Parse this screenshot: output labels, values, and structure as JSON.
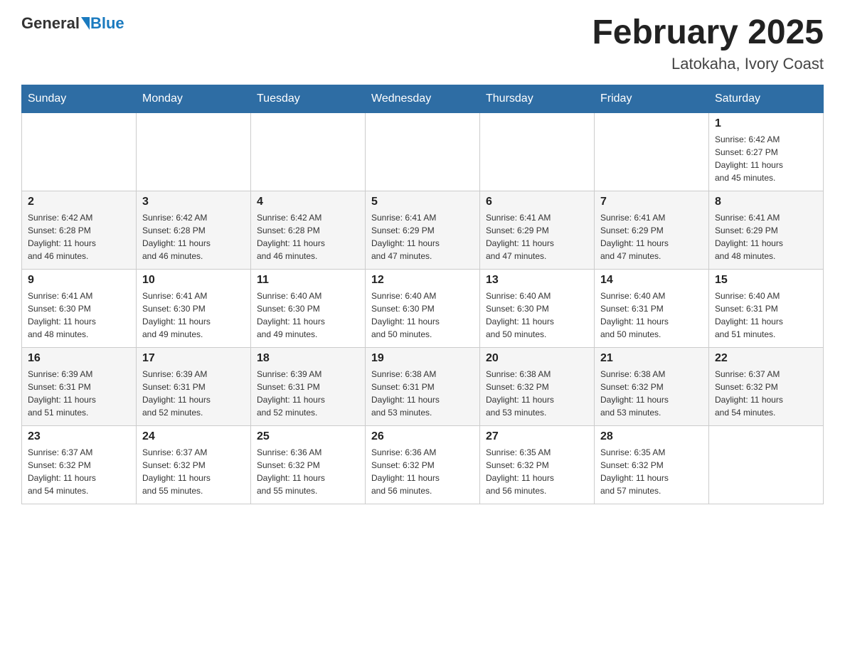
{
  "logo": {
    "general": "General",
    "blue": "Blue"
  },
  "title": "February 2025",
  "location": "Latokaha, Ivory Coast",
  "weekdays": [
    "Sunday",
    "Monday",
    "Tuesday",
    "Wednesday",
    "Thursday",
    "Friday",
    "Saturday"
  ],
  "weeks": [
    [
      {
        "day": "",
        "info": ""
      },
      {
        "day": "",
        "info": ""
      },
      {
        "day": "",
        "info": ""
      },
      {
        "day": "",
        "info": ""
      },
      {
        "day": "",
        "info": ""
      },
      {
        "day": "",
        "info": ""
      },
      {
        "day": "1",
        "info": "Sunrise: 6:42 AM\nSunset: 6:27 PM\nDaylight: 11 hours\nand 45 minutes."
      }
    ],
    [
      {
        "day": "2",
        "info": "Sunrise: 6:42 AM\nSunset: 6:28 PM\nDaylight: 11 hours\nand 46 minutes."
      },
      {
        "day": "3",
        "info": "Sunrise: 6:42 AM\nSunset: 6:28 PM\nDaylight: 11 hours\nand 46 minutes."
      },
      {
        "day": "4",
        "info": "Sunrise: 6:42 AM\nSunset: 6:28 PM\nDaylight: 11 hours\nand 46 minutes."
      },
      {
        "day": "5",
        "info": "Sunrise: 6:41 AM\nSunset: 6:29 PM\nDaylight: 11 hours\nand 47 minutes."
      },
      {
        "day": "6",
        "info": "Sunrise: 6:41 AM\nSunset: 6:29 PM\nDaylight: 11 hours\nand 47 minutes."
      },
      {
        "day": "7",
        "info": "Sunrise: 6:41 AM\nSunset: 6:29 PM\nDaylight: 11 hours\nand 47 minutes."
      },
      {
        "day": "8",
        "info": "Sunrise: 6:41 AM\nSunset: 6:29 PM\nDaylight: 11 hours\nand 48 minutes."
      }
    ],
    [
      {
        "day": "9",
        "info": "Sunrise: 6:41 AM\nSunset: 6:30 PM\nDaylight: 11 hours\nand 48 minutes."
      },
      {
        "day": "10",
        "info": "Sunrise: 6:41 AM\nSunset: 6:30 PM\nDaylight: 11 hours\nand 49 minutes."
      },
      {
        "day": "11",
        "info": "Sunrise: 6:40 AM\nSunset: 6:30 PM\nDaylight: 11 hours\nand 49 minutes."
      },
      {
        "day": "12",
        "info": "Sunrise: 6:40 AM\nSunset: 6:30 PM\nDaylight: 11 hours\nand 50 minutes."
      },
      {
        "day": "13",
        "info": "Sunrise: 6:40 AM\nSunset: 6:30 PM\nDaylight: 11 hours\nand 50 minutes."
      },
      {
        "day": "14",
        "info": "Sunrise: 6:40 AM\nSunset: 6:31 PM\nDaylight: 11 hours\nand 50 minutes."
      },
      {
        "day": "15",
        "info": "Sunrise: 6:40 AM\nSunset: 6:31 PM\nDaylight: 11 hours\nand 51 minutes."
      }
    ],
    [
      {
        "day": "16",
        "info": "Sunrise: 6:39 AM\nSunset: 6:31 PM\nDaylight: 11 hours\nand 51 minutes."
      },
      {
        "day": "17",
        "info": "Sunrise: 6:39 AM\nSunset: 6:31 PM\nDaylight: 11 hours\nand 52 minutes."
      },
      {
        "day": "18",
        "info": "Sunrise: 6:39 AM\nSunset: 6:31 PM\nDaylight: 11 hours\nand 52 minutes."
      },
      {
        "day": "19",
        "info": "Sunrise: 6:38 AM\nSunset: 6:31 PM\nDaylight: 11 hours\nand 53 minutes."
      },
      {
        "day": "20",
        "info": "Sunrise: 6:38 AM\nSunset: 6:32 PM\nDaylight: 11 hours\nand 53 minutes."
      },
      {
        "day": "21",
        "info": "Sunrise: 6:38 AM\nSunset: 6:32 PM\nDaylight: 11 hours\nand 53 minutes."
      },
      {
        "day": "22",
        "info": "Sunrise: 6:37 AM\nSunset: 6:32 PM\nDaylight: 11 hours\nand 54 minutes."
      }
    ],
    [
      {
        "day": "23",
        "info": "Sunrise: 6:37 AM\nSunset: 6:32 PM\nDaylight: 11 hours\nand 54 minutes."
      },
      {
        "day": "24",
        "info": "Sunrise: 6:37 AM\nSunset: 6:32 PM\nDaylight: 11 hours\nand 55 minutes."
      },
      {
        "day": "25",
        "info": "Sunrise: 6:36 AM\nSunset: 6:32 PM\nDaylight: 11 hours\nand 55 minutes."
      },
      {
        "day": "26",
        "info": "Sunrise: 6:36 AM\nSunset: 6:32 PM\nDaylight: 11 hours\nand 56 minutes."
      },
      {
        "day": "27",
        "info": "Sunrise: 6:35 AM\nSunset: 6:32 PM\nDaylight: 11 hours\nand 56 minutes."
      },
      {
        "day": "28",
        "info": "Sunrise: 6:35 AM\nSunset: 6:32 PM\nDaylight: 11 hours\nand 57 minutes."
      },
      {
        "day": "",
        "info": ""
      }
    ]
  ]
}
